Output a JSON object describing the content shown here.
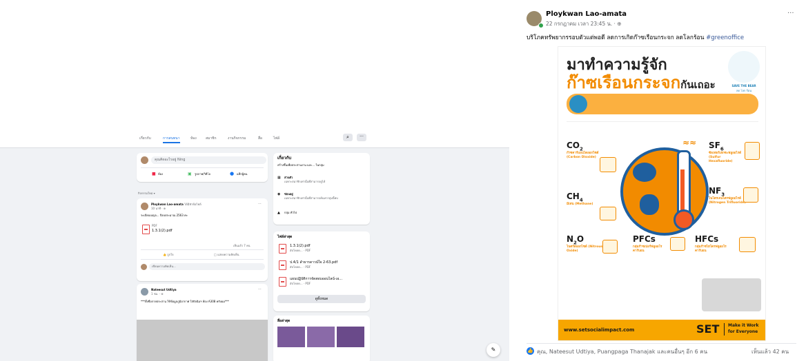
{
  "group": {
    "tabs": [
      {
        "label": "เกี่ยวกับ",
        "active": false
      },
      {
        "label": "การสนทนา",
        "active": true
      },
      {
        "label": "ห้อง",
        "active": false
      },
      {
        "label": "สมาชิก",
        "active": false
      },
      {
        "label": "งานกิจกรรม",
        "active": false
      },
      {
        "label": "สื่อ",
        "active": false
      },
      {
        "label": "ไฟล์",
        "active": false
      }
    ],
    "composer": {
      "placeholder": "คุณคิดอะไรอยู่ Ning",
      "actions": [
        "ห้อง",
        "รูปภาพ/วิดีโอ",
        "แท็กผู้คน"
      ]
    },
    "feed_sort": "กิจกรรมใหม่",
    "post1": {
      "author": "Ploykwan Lao-amata",
      "author_suffix": "ได้มีหัวข้อไฟล์",
      "time": "10 นาที · ⊕",
      "text": "ระเบียบเบญจ... ปีงบประมาณ 2563 ค่ะ",
      "file_type": "PDF",
      "file_name": "1.3.1(2).pdf",
      "seen": "เห็นแล้ว 7 คน",
      "like": "ถูกใจ",
      "comment": "แสดงความคิดเห็น",
      "comment_placeholder": "เขียนความคิดเห็น..."
    },
    "post2": {
      "author": "Nateesut Udtiya",
      "time": "1 ชม. · ⊕",
      "text": "***ตั้งชื่อกายประสาน ใช้ข้อมูลภูมิอากาศ ใส่ปัจฉิมฯ ห้อง A308 ครับผม***"
    },
    "about": {
      "title": "เกี่ยวกับ",
      "desc": "สร้างขึ้นเพื่อประสานงาน และ... ในกลุ่ม",
      "private_title": "ส่วนตัว",
      "private_desc": "เฉพาะสมาชิกเท่านั้นที่สามารถดูได้",
      "visible_title": "ซ่อนอยู่",
      "visible_desc": "เฉพาะสมาชิกเท่านั้นที่สามารถค้นหากลุ่มนี้พบ",
      "location": "กลุ่ม ทั่วไป"
    },
    "files": {
      "title": "ไฟล์ล่าสุด",
      "items": [
        {
          "name": "1.3.1(2).pdf",
          "meta": "อัปโหลด... · PDF"
        },
        {
          "name": "ป.4/1 ลำธารดาวน์ใจ 2-63.pdf",
          "meta": "อัปโหลด... · PDF"
        },
        {
          "name": "แผนปฏิบัติการจัดสอบออนไลน์-เอ...",
          "meta": "อัปโหลด... · PDF"
        }
      ],
      "see_all": "ดูทั้งหมด"
    },
    "media": {
      "title": "สื่อล่าสุด"
    }
  },
  "post": {
    "author": "Ploykwan Lao-amata",
    "date": "22 กรกฎาคม เวลา 23:45 น. · ⊕",
    "caption": "บริโภคทรัพยากรรอบตัวแต่พอดี ลดการเกิดก๊าซเรือนกระจก ลดโลกร้อน",
    "hashtag": "#greenoffice",
    "reactions_text": "คุณ, Nateesut Udtiya, Puangpaga Thanajak และคนอื่นๆ อีก 6 คน",
    "seen": "เห็นแล้ว 42 คน",
    "more": "···"
  },
  "poster": {
    "heading1": "มาทำความรู้จัก",
    "heading2": "ก๊าซเรือนกระจก",
    "heading3": "กันเถอะ",
    "badge": "SAVE THE BEAR",
    "badge_sub": "ลด โลก ร้อน",
    "gases": [
      {
        "formula": "CO",
        "sub": "2",
        "name": "ก๊าซคาร์บอนไดออกไซด์ (Carbon Dioxide)"
      },
      {
        "formula": "CH",
        "sub": "4",
        "name": "มีเทน (Methane)"
      },
      {
        "formula": "N",
        "sub": "2",
        "tail": "O",
        "name": "ไนตรัสออกไซด์ (Nitrous Oxide)"
      },
      {
        "formula": "PFCs",
        "sub": "",
        "name": "กลุ่มก๊าซเปอร์ฟลูออโรคาร์บอน"
      },
      {
        "formula": "HFCs",
        "sub": "",
        "name": "กลุ่มก๊าซไฮโดรฟลูออโรคาร์บอน"
      },
      {
        "formula": "SF",
        "sub": "6",
        "name": "ซัลเฟอร์เฮกซะฟลูออไรด์ (Sulfur Hexafluoride)"
      },
      {
        "formula": "NF",
        "sub": "3",
        "name": "ไนโตรเจนไตรฟลูออไรด์ (Nitrogen Trifluoride)"
      }
    ],
    "footer_url": "www.setsocialimpact.com",
    "brand": "SET",
    "tagline1": "Make it Work",
    "tagline2": "for Everyone"
  },
  "colors": {
    "accent": "#1b74e4",
    "orange": "#f28b00",
    "poster_bg": "#ffffff",
    "footer": "#f7a600"
  }
}
